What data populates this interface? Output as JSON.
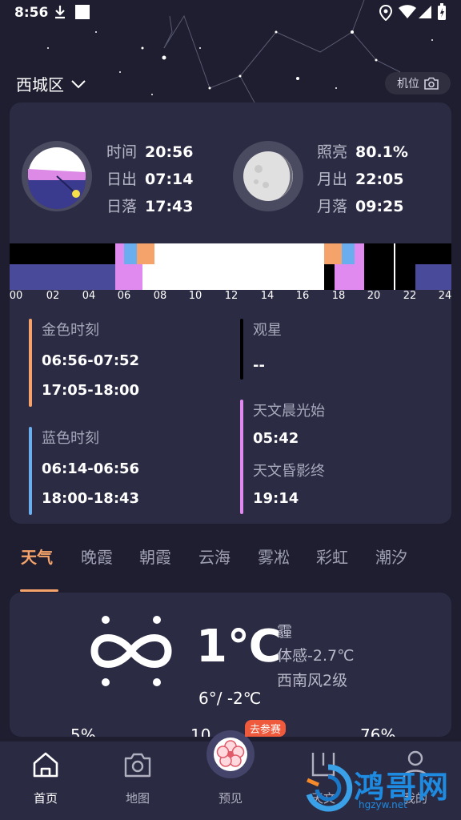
{
  "status_bar": {
    "time": "8:56"
  },
  "location": {
    "name": "西城区",
    "camera_label": "机位"
  },
  "sun": {
    "time_label": "时间",
    "time_value": "20:56",
    "rise_label": "日出",
    "rise_value": "07:14",
    "set_label": "日落",
    "set_value": "17:43"
  },
  "moon": {
    "illum_label": "照亮",
    "illum_value": "80.1%",
    "rise_label": "月出",
    "rise_value": "22:05",
    "set_label": "月落",
    "set_value": "09:25"
  },
  "timeline": {
    "ticks": [
      "00",
      "02",
      "04",
      "06",
      "08",
      "10",
      "12",
      "14",
      "16",
      "18",
      "20",
      "22",
      "24"
    ]
  },
  "golden_hour": {
    "label": "金色时刻",
    "morning": "06:56-07:52",
    "evening": "17:05-18:00"
  },
  "blue_hour": {
    "label": "蓝色时刻",
    "morning": "06:14-06:56",
    "evening": "18:00-18:43"
  },
  "stargazing": {
    "label": "观星",
    "value": "--"
  },
  "astro_dawn": {
    "label": "天文晨光始",
    "value": "05:42"
  },
  "astro_dusk": {
    "label": "天文昏影终",
    "value": "19:14"
  },
  "tabs": [
    "天气",
    "晚霞",
    "朝霞",
    "云海",
    "雾凇",
    "彩虹",
    "潮汐"
  ],
  "weather": {
    "temp": "1℃",
    "condition": "霾",
    "feels_like": "体感-2.7℃",
    "wind": "西南风2级",
    "range": "6°/ -2℃",
    "partial_left": "5%",
    "partial_mid": "10",
    "partial_right": "76%"
  },
  "badge": {
    "label": "去参赛"
  },
  "nav": {
    "home": "首页",
    "map": "地图",
    "preview": "预见",
    "astro": "天文",
    "mine": "我的"
  },
  "watermark": {
    "text": "鸿哥网",
    "sub": "hgzyw.net"
  },
  "colors": {
    "accent": "#f5a36a",
    "golden": "#f5a36a",
    "blue_hour": "#6aaef0",
    "astro": "#e08af0",
    "night": "#4a4a9a"
  }
}
